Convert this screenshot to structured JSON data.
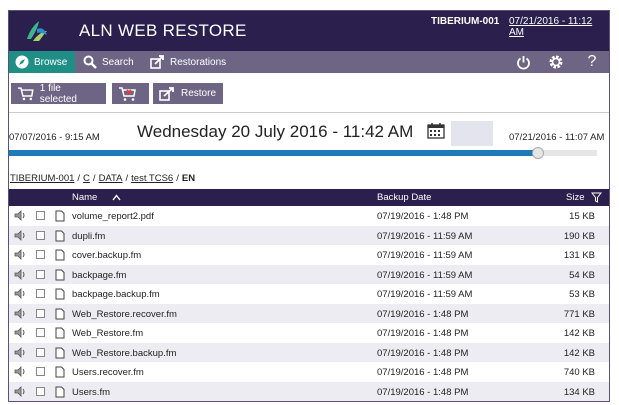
{
  "header": {
    "app_title": "ALN WEB RESTORE",
    "host": "TIBERIUM-001",
    "datetime": "07/21/2016 - 11:12 AM"
  },
  "nav": {
    "browse": "Browse",
    "search": "Search",
    "restorations": "Restorations"
  },
  "toolbar": {
    "selected": "1 file selected",
    "restore": "Restore"
  },
  "timeline": {
    "start": "07/07/2016 - 9:15 AM",
    "current": "Wednesday 20 July 2016 - 11:42 AM",
    "end": "07/21/2016 - 11:07 AM",
    "position_fraction": 0.9
  },
  "breadcrumb": [
    "TIBERIUM-001",
    "C",
    "DATA",
    "test TCS6",
    "EN"
  ],
  "table": {
    "columns": {
      "name": "Name",
      "backup_date": "Backup Date",
      "size": "Size"
    },
    "rows": [
      {
        "name": "volume_report2.pdf",
        "date": "07/19/2016 - 1:48 PM",
        "size": "15 KB"
      },
      {
        "name": "dupli.fm",
        "date": "07/19/2016 - 11:59 AM",
        "size": "190 KB"
      },
      {
        "name": "cover.backup.fm",
        "date": "07/19/2016 - 11:59 AM",
        "size": "131 KB"
      },
      {
        "name": "backpage.fm",
        "date": "07/19/2016 - 11:59 AM",
        "size": "54 KB"
      },
      {
        "name": "backpage.backup.fm",
        "date": "07/19/2016 - 11:59 AM",
        "size": "53 KB"
      },
      {
        "name": "Web_Restore.recover.fm",
        "date": "07/19/2016 - 1:48 PM",
        "size": "771 KB"
      },
      {
        "name": "Web_Restore.fm",
        "date": "07/19/2016 - 1:48 PM",
        "size": "142 KB"
      },
      {
        "name": "Web_Restore.backup.fm",
        "date": "07/19/2016 - 1:48 PM",
        "size": "142 KB"
      },
      {
        "name": "Users.recover.fm",
        "date": "07/19/2016 - 1:48 PM",
        "size": "740 KB"
      },
      {
        "name": "Users.fm",
        "date": "07/19/2016 - 1:48 PM",
        "size": "134 KB"
      }
    ]
  },
  "colors": {
    "header_bg": "#2a1f4d",
    "nav_bg": "#6e6585",
    "active_tab": "#1f8f86",
    "timeline_fill": "#1f7ab8"
  }
}
